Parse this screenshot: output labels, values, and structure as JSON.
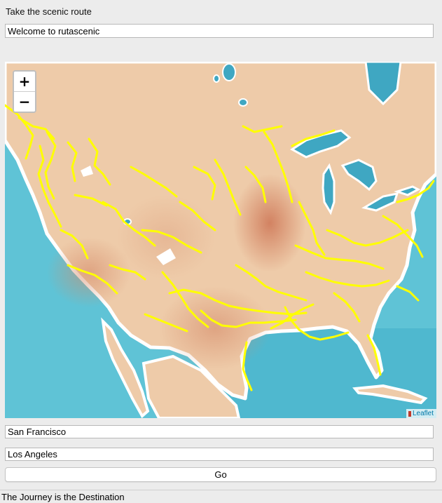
{
  "window": {
    "heading": "Take the scenic route",
    "welcome_value": "Welcome to rutascenic"
  },
  "map": {
    "zoom_in_label": "+",
    "zoom_out_label": "−",
    "attribution": "Leaflet",
    "route_color": "#ffff00",
    "water_color": "#5fc3d6",
    "land_color": "#eecba9"
  },
  "form": {
    "origin_value": "San Francisco",
    "destination_value": "Los Angeles",
    "go_label": "Go"
  },
  "status": {
    "text": "The Journey is the Destination"
  }
}
